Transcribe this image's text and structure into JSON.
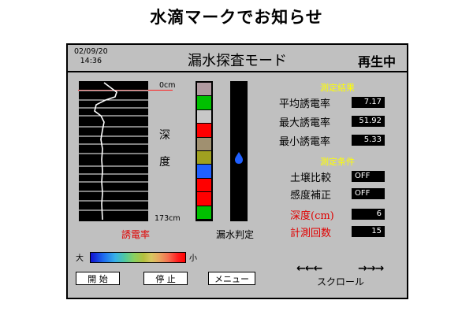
{
  "page_title": "水滴マークでお知らせ",
  "panel": {
    "date": "02/09/20",
    "time": "14:36",
    "mode_title": "漏水探査モード",
    "status": "再生中",
    "depth_top_label": "0cm",
    "depth_bottom_label": "173cm",
    "depth_vertical_label": "深",
    "depth_vertical_label_2": "度",
    "permittivity_label": "誘電率",
    "leak_judgement_label": "漏水判定",
    "scale": {
      "left_label": "大",
      "right_label": "小"
    },
    "results": {
      "heading": "測定結果",
      "rows": [
        {
          "label": "平均誘電率",
          "value": "7.17"
        },
        {
          "label": "最大誘電率",
          "value": "51.92"
        },
        {
          "label": "最小誘電率",
          "value": "5.33"
        }
      ]
    },
    "conditions": {
      "heading": "測定条件",
      "rows": [
        {
          "label": "土壌比較",
          "value": "OFF"
        },
        {
          "label": "感度補正",
          "value": "OFF"
        },
        {
          "label": "深度(cm)",
          "value": "6"
        },
        {
          "label": "計測回数",
          "value": "15"
        }
      ]
    },
    "buttons": {
      "start": "開 始",
      "stop": "停 止",
      "menu": "メニュー"
    },
    "scroll": {
      "left_arrows": "←←←",
      "right_arrows": "→→→",
      "label": "スクロール"
    },
    "strip_colors": [
      "#b09aa0",
      "#00c000",
      "#c8c8c8",
      "#ff0000",
      "#a09070",
      "#a0a020",
      "#2060ff",
      "#ff0000",
      "#ff0000",
      "#00c000"
    ],
    "leak_icon": "water-drop-icon",
    "accent_red": "#e00000",
    "heading_yellow": "#ffff00"
  }
}
